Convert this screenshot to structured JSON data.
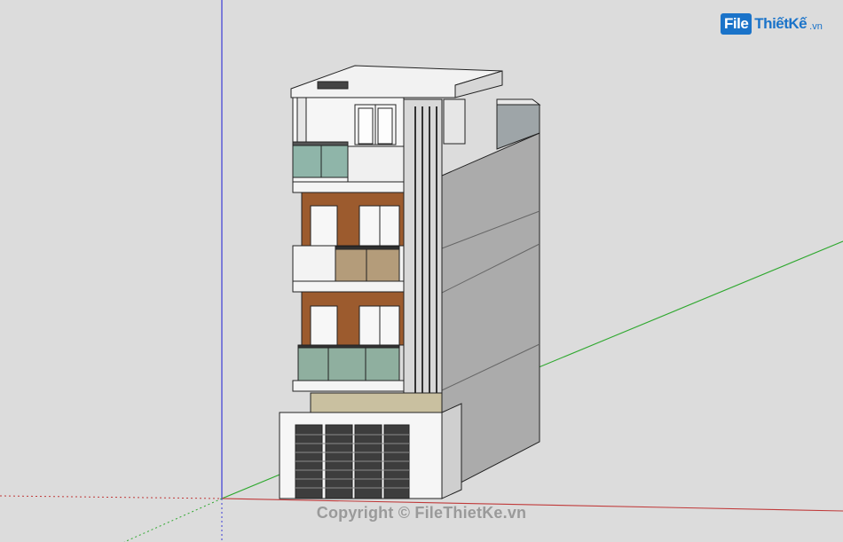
{
  "logo": {
    "brand_box": "File",
    "brand_name": "ThiếtKế",
    "brand_tld": ".vn"
  },
  "watermark": "Copyright © FileThietKe.vn",
  "colors": {
    "background": "#dcdcdc",
    "axis_blue": "#3b3bd6",
    "axis_green": "#2fa82f",
    "axis_red": "#c03a3a",
    "wood": "#9c5b2e",
    "glass": "#8fb5a9",
    "wall_light": "#f5f5f5",
    "wall_side": "#a9a9a9"
  }
}
